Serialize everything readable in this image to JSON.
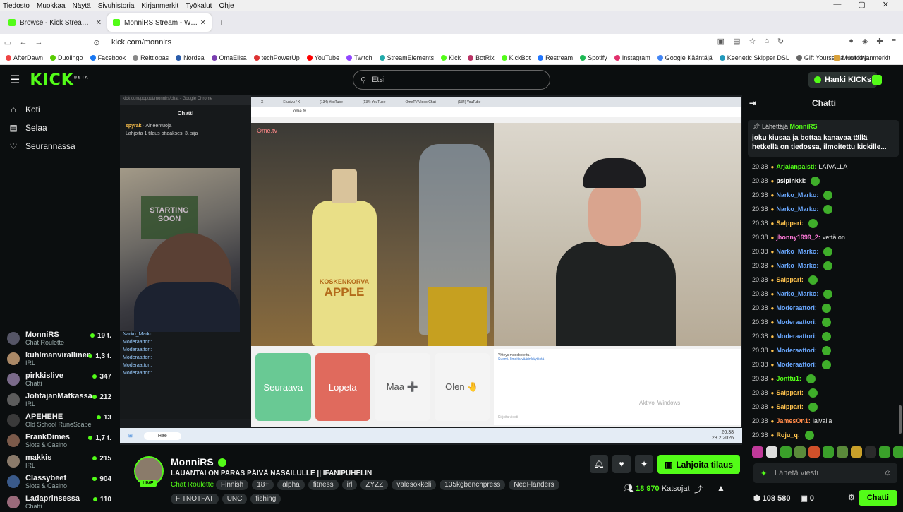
{
  "os_menu": [
    "Tiedosto",
    "Muokkaa",
    "Näytä",
    "Sivuhistoria",
    "Kirjanmerkit",
    "Työkalut",
    "Ohje"
  ],
  "tabs": [
    {
      "label": "Browse - Kick Streaming"
    },
    {
      "label": "MonniRS Stream - Watch Live"
    }
  ],
  "url": "kick.com/monnirs",
  "bookmarks": [
    "AfterDawn",
    "Duolingo",
    "Facebook",
    "Reittiopas",
    "Nordea",
    "OmaElisa",
    "techPowerUp",
    "YouTube",
    "Twitch",
    "StreamElements",
    "Kick",
    "BotRix",
    "KickBot",
    "Restream",
    "Spotify",
    "Instagram",
    "Google Kääntäjä",
    "Keenetic Skipper DSL",
    "Gift Yourself a Holiday..."
  ],
  "bookmarks_other": "Muut kirjanmerkit",
  "header": {
    "logo": "KICK",
    "logo_sup": "BETA",
    "search_placeholder": "Etsi",
    "kicks_button": "Hanki KICKs"
  },
  "sidebar": {
    "nav": [
      {
        "label": "Koti",
        "icon": "⌂"
      },
      {
        "label": "Selaa",
        "icon": "▤"
      },
      {
        "label": "Seurannassa",
        "icon": "♡"
      }
    ],
    "channels": [
      {
        "name": "MonniRS",
        "category": "Chat Roulette",
        "viewers": "19 t."
      },
      {
        "name": "kuhlmanvirallinen",
        "category": "IRL",
        "viewers": "1,3 t."
      },
      {
        "name": "pirkkislive",
        "category": "Chatti",
        "viewers": "347"
      },
      {
        "name": "JohtajanMatkassa",
        "category": "IRL",
        "viewers": "212"
      },
      {
        "name": "APEHEHE",
        "category": "Old School RuneScape",
        "viewers": "13"
      },
      {
        "name": "FrankDimes",
        "category": "Slots & Casino",
        "viewers": "1,7 t."
      },
      {
        "name": "makkis",
        "category": "IRL",
        "viewers": "215"
      },
      {
        "name": "Classybeef",
        "category": "Slots & Casino",
        "viewers": "904"
      },
      {
        "name": "Ladaprinsessa",
        "category": "Chatti",
        "viewers": "110"
      }
    ]
  },
  "stream_overlay": {
    "popout_title": "kick.com/popout/monnirs/chat - Google Chrome",
    "popout_chat": "Chatti",
    "popout_user": "spyrak",
    "popout_badge": "Aineentuoja",
    "popout_gift": "Lahjoita 1 tilaus ottaaksesi 3. sija",
    "poster_text": "STARTING SOON",
    "mini_msgs": [
      "Narko_Marko:",
      "Moderaattori:",
      "Moderaattori:",
      "Moderaattori:",
      "Moderaattori:",
      "Moderaattori:"
    ],
    "inner_tabs": [
      "X",
      "Etusivu / X",
      "(134) YouTube",
      "(134) YouTube",
      "OmeTV Video Chat -",
      "(134) YouTube"
    ],
    "inner_url": "ome.tv",
    "ome_logo": "Ome.tv",
    "bottle_brand": "KOSKENKORVA",
    "bottle_flavor": "APPLE",
    "ome_buttons": [
      "Seuraava",
      "Lopeta",
      "Maa ➕",
      "Olen 🤚"
    ],
    "ome_chat": [
      "Yhteys muodostettu.",
      "Suomi. Ilmoita väärinkäytöstä"
    ],
    "ome_input": "Kirjoita viesti",
    "activate": "Aktivoi Windows",
    "taskbar_time": "20.38",
    "taskbar_date": "28.2.2026",
    "taskbar_search": "Hae"
  },
  "stream_info": {
    "name": "MonniRS",
    "title": "LAUANTAI ON PARAS PÄIVÄ NASAILULLE || IFANIPUHELIN",
    "category": "Chat Roulette",
    "tags": [
      "Finnish",
      "18+",
      "alpha",
      "fitness",
      "irl",
      "ZYZZ",
      "valesokkeli",
      "135kgbenchpress",
      "NedFlanders"
    ],
    "tags2": [
      "FITNOTFAT",
      "UNC",
      "fishing"
    ],
    "live": "LIVE",
    "subscribe": "Lahjoita tilaus",
    "viewers": "18 970",
    "viewers_label": "Katsojat"
  },
  "chat": {
    "title": "Chatti",
    "pinned_by_label": "Lähettäjä",
    "pinned_by": "MonniRS",
    "pinned_text": "joku kiusaa ja bottaa kanavaa tällä hetkellä on tiedossa, ilmoitettu kickille...",
    "messages": [
      {
        "time": "20.38",
        "user": "Arjalanpaisti:",
        "text": "LAIVALLA",
        "color": "#53fc18"
      },
      {
        "time": "20.38",
        "user": "psipinkki:",
        "text": "",
        "color": "#ffffff"
      },
      {
        "time": "20.38",
        "user": "Narko_Marko:",
        "text": "",
        "color": "#6aa8ff"
      },
      {
        "time": "20.38",
        "user": "Narko_Marko:",
        "text": "",
        "color": "#6aa8ff"
      },
      {
        "time": "20.38",
        "user": "Salppari:",
        "text": "",
        "color": "#ffc34d"
      },
      {
        "time": "20.38",
        "user": "jhonny1999_2:",
        "text": "vettä on",
        "color": "#ff7ad9"
      },
      {
        "time": "20.38",
        "user": "Narko_Marko:",
        "text": "",
        "color": "#6aa8ff"
      },
      {
        "time": "20.38",
        "user": "Narko_Marko:",
        "text": "",
        "color": "#6aa8ff"
      },
      {
        "time": "20.38",
        "user": "Salppari:",
        "text": "",
        "color": "#ffc34d"
      },
      {
        "time": "20.38",
        "user": "Narko_Marko:",
        "text": "",
        "color": "#6aa8ff"
      },
      {
        "time": "20.38",
        "user": "Moderaattori:",
        "text": "",
        "color": "#6aa8ff"
      },
      {
        "time": "20.38",
        "user": "Moderaattori:",
        "text": "",
        "color": "#6aa8ff"
      },
      {
        "time": "20.38",
        "user": "Moderaattori:",
        "text": "",
        "color": "#6aa8ff"
      },
      {
        "time": "20.38",
        "user": "Moderaattori:",
        "text": "",
        "color": "#6aa8ff"
      },
      {
        "time": "20.38",
        "user": "Moderaattori:",
        "text": "",
        "color": "#6aa8ff"
      },
      {
        "time": "20.38",
        "user": "Jonttu1:",
        "text": "",
        "color": "#53fc18"
      },
      {
        "time": "20.38",
        "user": "Salppari:",
        "text": "",
        "color": "#ffc34d"
      },
      {
        "time": "20.38",
        "user": "Salppari:",
        "text": "",
        "color": "#ffc34d"
      },
      {
        "time": "20.38",
        "user": "JamesOn1:",
        "text": "laivalla",
        "color": "#ff8a4a"
      },
      {
        "time": "20.38",
        "user": "Roju_q:",
        "text": "",
        "color": "#ffc34d"
      }
    ],
    "input_placeholder": "Lähetä viesti",
    "points": "108 580",
    "count": "0",
    "send_button": "Chatti"
  }
}
